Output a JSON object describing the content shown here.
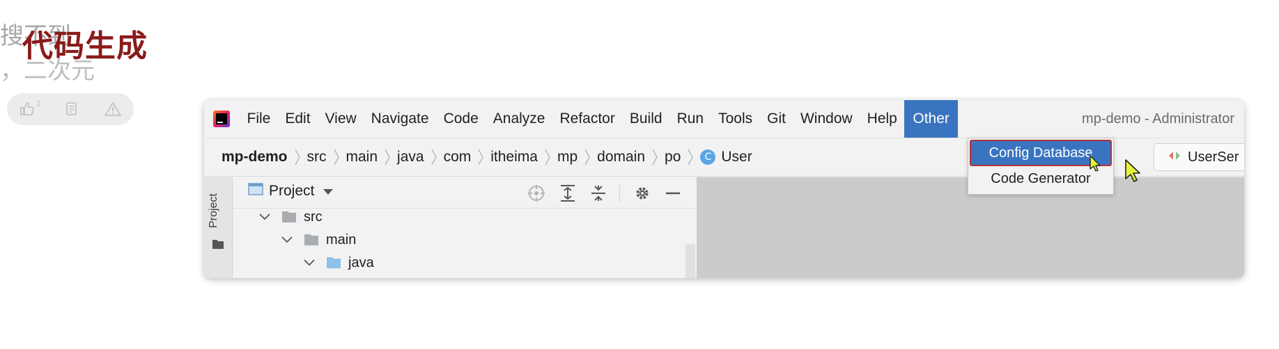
{
  "page": {
    "heading": "代码生成",
    "overlay_line1": "搜不到",
    "overlay_line2": "，二次元",
    "reactions": {
      "like_count": "2"
    }
  },
  "ide": {
    "window_title": "mp-demo - Administrator",
    "menu": {
      "file": "File",
      "edit": "Edit",
      "view": "View",
      "navigate": "Navigate",
      "code": "Code",
      "analyze": "Analyze",
      "refactor": "Refactor",
      "build": "Build",
      "run": "Run",
      "tools": "Tools",
      "git": "Git",
      "window": "Window",
      "help": "Help",
      "other": "Other"
    },
    "breadcrumb": {
      "project": "mp-demo",
      "src": "src",
      "main": "main",
      "java": "java",
      "com": "com",
      "itheima": "itheima",
      "mp": "mp",
      "domain": "domain",
      "po": "po",
      "class_badge": "C",
      "class": "User"
    },
    "run_config": "UserSer",
    "side_tab": "Project",
    "project_panel": {
      "title": "Project",
      "tree": {
        "src": "src",
        "main": "main",
        "java": "java"
      }
    },
    "other_menu": {
      "config_database": "Config Database",
      "code_generator": "Code Generator"
    }
  },
  "colors": {
    "accent": "#3a74c0",
    "heading": "#8b1a1a",
    "selection_border": "#b0323a",
    "cursor": "#e8f43a"
  }
}
